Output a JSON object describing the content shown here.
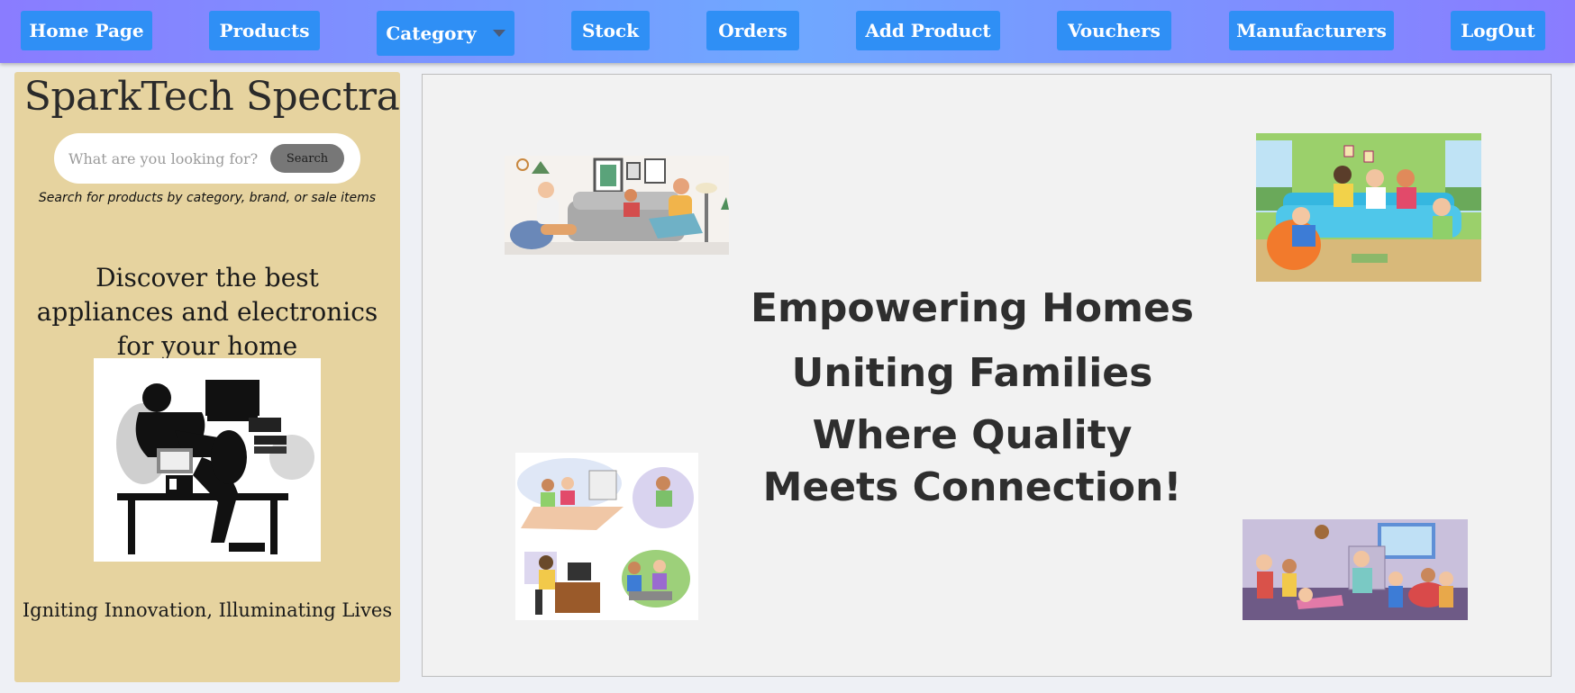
{
  "nav": {
    "home": "Home Page",
    "products": "Products",
    "category": "Category",
    "stock": "Stock",
    "orders": "Orders",
    "add_product": "Add Product",
    "vouchers": "Vouchers",
    "manufacturers": "Manufacturers",
    "logout": "LogOut"
  },
  "sidebar": {
    "brand": "SparkTech Spectra",
    "search": {
      "placeholder": "What are you looking for?",
      "button": "Search",
      "hint": "Search for products by category, brand, or sale items"
    },
    "discover": "Discover the best appliances and electronics for your home",
    "tagline": "Igniting Innovation, Illuminating Lives"
  },
  "main": {
    "line1": "Empowering Homes",
    "line2": "Uniting Families",
    "line3": "Where Quality Meets Connection!"
  },
  "colors": {
    "nav_button": "#2f8ff5",
    "sidebar_bg": "#e6d39f",
    "main_bg": "#f2f2f2"
  }
}
